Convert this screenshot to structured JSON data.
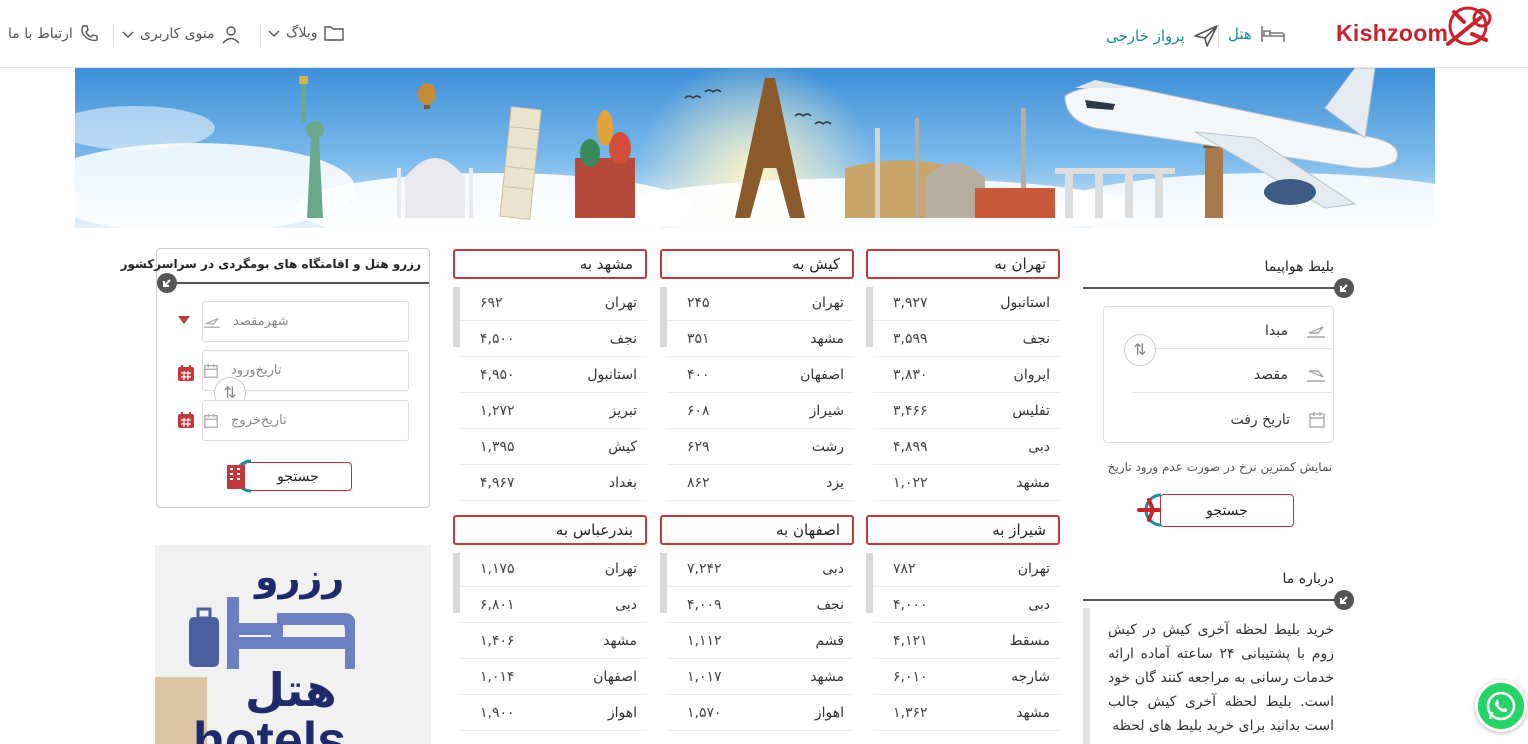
{
  "header": {
    "logo_text": "Kishzoom",
    "nav_hotel": "هتل",
    "nav_flight": "پرواز خارجی",
    "nav_blog": "وبلاگ",
    "nav_user_menu": "منوی کاربری",
    "nav_contact": "ارتباط با ما"
  },
  "flight_search": {
    "title": "بلیط هواپیما",
    "origin_placeholder": "مبدا",
    "destination_placeholder": "مقصد",
    "date_placeholder": "تاریخ رفت",
    "note": "نمایش کمترین نرخ در صورت عدم ورود تاریخ",
    "search_label": "جستجو"
  },
  "about": {
    "title": "درباره ما",
    "text": "خرید بلیط لحظه آخری کیش در کیش زوم با پشتیبانی ۲۴ ساعته آماده ارائه خدمات رسانی به مراجعه کنند گان خود است. بلیط لحظه آخری کیش جالب است بدانید برای خرید بلیط های لحظه"
  },
  "routes": [
    {
      "heading": "تهران به",
      "rows": [
        {
          "city": "استانبول",
          "price": "۳,۹۲۷"
        },
        {
          "city": "نجف",
          "price": "۳,۵۹۹"
        },
        {
          "city": "ایروان",
          "price": "۳,۸۳۰"
        },
        {
          "city": "تفلیس",
          "price": "۳,۴۶۶"
        },
        {
          "city": "دبی",
          "price": "۴,۸۹۹"
        },
        {
          "city": "مشهد",
          "price": "۱,۰۲۲"
        }
      ]
    },
    {
      "heading": "کیش به",
      "rows": [
        {
          "city": "تهران",
          "price": "۲۴۵"
        },
        {
          "city": "مشهد",
          "price": "۳۵۱"
        },
        {
          "city": "اصفهان",
          "price": "۴۰۰"
        },
        {
          "city": "شیراز",
          "price": "۶۰۸"
        },
        {
          "city": "رشت",
          "price": "۶۲۹"
        },
        {
          "city": "یزد",
          "price": "۸۶۲"
        }
      ]
    },
    {
      "heading": "مشهد به",
      "rows": [
        {
          "city": "تهران",
          "price": "۶۹۲"
        },
        {
          "city": "نجف",
          "price": "۴,۵۰۰"
        },
        {
          "city": "استانبول",
          "price": "۴,۹۵۰"
        },
        {
          "city": "تبریز",
          "price": "۱,۲۷۲"
        },
        {
          "city": "کیش",
          "price": "۱,۳۹۵"
        },
        {
          "city": "بغداد",
          "price": "۴,۹۶۷"
        }
      ]
    },
    {
      "heading": "شیراز به",
      "rows": [
        {
          "city": "تهران",
          "price": "۷۸۲"
        },
        {
          "city": "دبی",
          "price": "۴,۰۰۰"
        },
        {
          "city": "مسقط",
          "price": "۴,۱۲۱"
        },
        {
          "city": "شارجه",
          "price": "۶,۰۱۰"
        },
        {
          "city": "مشهد",
          "price": "۱,۳۶۲"
        }
      ]
    },
    {
      "heading": "اصفهان به",
      "rows": [
        {
          "city": "دبی",
          "price": "۷,۲۴۲"
        },
        {
          "city": "نجف",
          "price": "۴,۰۰۹"
        },
        {
          "city": "قشم",
          "price": "۱,۱۱۲"
        },
        {
          "city": "مشهد",
          "price": "۱,۰۱۷"
        },
        {
          "city": "اهواز",
          "price": "۱,۵۷۰"
        }
      ]
    },
    {
      "heading": "بندرعباس به",
      "rows": [
        {
          "city": "تهران",
          "price": "۱,۱۷۵"
        },
        {
          "city": "دبی",
          "price": "۶,۸۰۱"
        },
        {
          "city": "مشهد",
          "price": "۱,۴۰۶"
        },
        {
          "city": "اصفهان",
          "price": "۱,۰۱۴"
        },
        {
          "city": "اهواز",
          "price": "۱,۹۰۰"
        }
      ]
    }
  ],
  "hotel_search": {
    "title": "رزرو هتل و اقامتگاه های بومگردی در سراسرکشور",
    "city_placeholder": "شهرمقصد",
    "checkin_placeholder": "تاریخ‌ورود",
    "checkout_placeholder": "تاریخ‌خروج",
    "search_label": "جستجو"
  },
  "hotel_ad": {
    "line1": "رزرو",
    "line2": "هتل",
    "line3": "hotels"
  },
  "colors": {
    "accent": "#c0393b",
    "link": "#1a8c9c",
    "whatsapp": "#25d366"
  }
}
